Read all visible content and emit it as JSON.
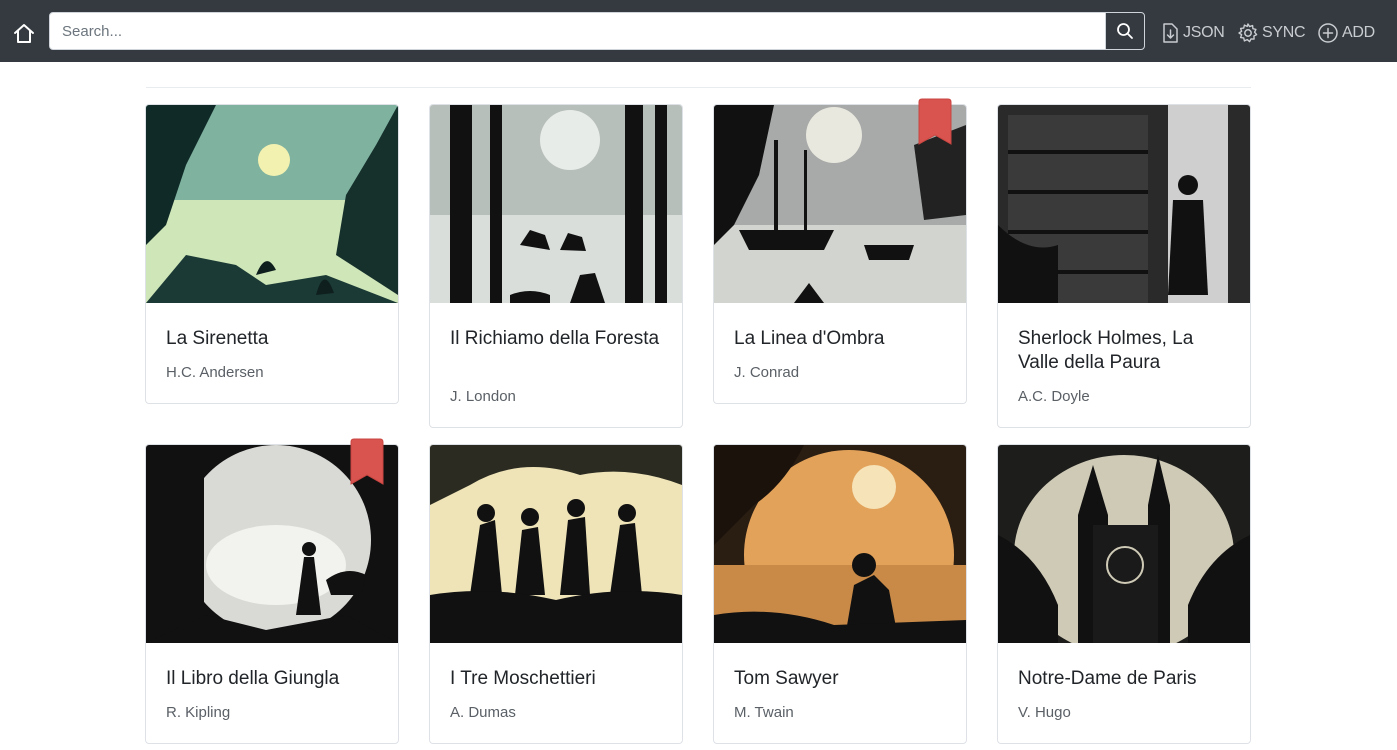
{
  "header": {
    "search_placeholder": "Search...",
    "actions": [
      {
        "label": "JSON",
        "icon": "file-download-icon"
      },
      {
        "label": "SYNC",
        "icon": "gear-icon"
      },
      {
        "label": "ADD",
        "icon": "plus-circle-icon"
      }
    ]
  },
  "colors": {
    "navbar": "#343a40",
    "bookmark": "#d9534f"
  },
  "books": [
    {
      "title": "La Sirenetta",
      "author": "H.C. Andersen",
      "bookmarked": false
    },
    {
      "title": "Il Richiamo della Foresta",
      "author": "J. London",
      "bookmarked": false
    },
    {
      "title": "La Linea d'Ombra",
      "author": "J. Conrad",
      "bookmarked": true
    },
    {
      "title": "Sherlock Holmes, La Valle della Paura",
      "author": "A.C. Doyle",
      "bookmarked": false
    },
    {
      "title": "Il Libro della Giungla",
      "author": "R. Kipling",
      "bookmarked": true
    },
    {
      "title": "I Tre Moschettieri",
      "author": "A. Dumas",
      "bookmarked": false
    },
    {
      "title": "Tom Sawyer",
      "author": "M. Twain",
      "bookmarked": false
    },
    {
      "title": "Notre-Dame de Paris",
      "author": "V. Hugo",
      "bookmarked": false
    }
  ]
}
